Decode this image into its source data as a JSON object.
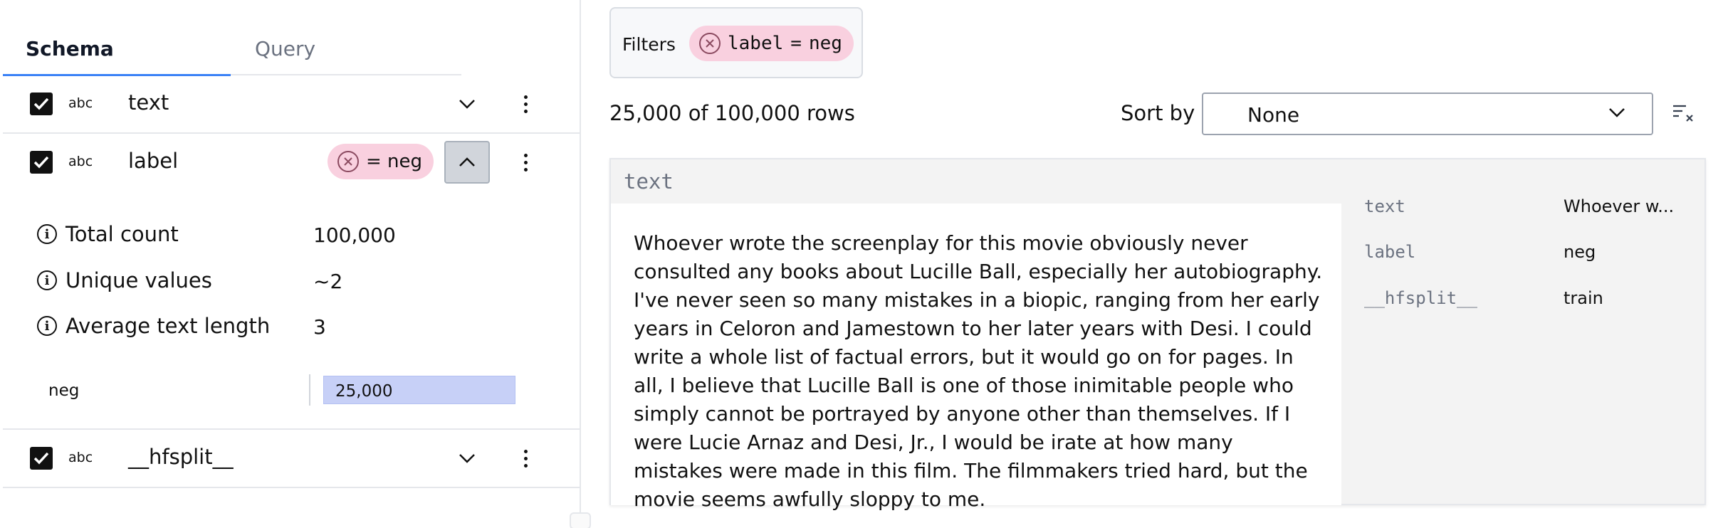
{
  "tabs": {
    "schema": "Schema",
    "query": "Query"
  },
  "schema_fields": [
    {
      "type_badge": "abc",
      "name": "text"
    },
    {
      "type_badge": "abc",
      "name": "label",
      "filter_text": "= neg"
    },
    {
      "type_badge": "abc",
      "name": "__hfsplit__"
    }
  ],
  "label_stats": {
    "total_count": {
      "label": "Total count",
      "value": "100,000"
    },
    "unique_values": {
      "label": "Unique values",
      "value": "~2"
    },
    "avg_text_length": {
      "label": "Average text length",
      "value": "3"
    },
    "histogram": [
      {
        "label": "neg",
        "value": "25,000",
        "fraction": 1.0
      }
    ]
  },
  "filters": {
    "label": "Filters",
    "pills": [
      {
        "field": "label",
        "op": "=",
        "value": "neg"
      }
    ]
  },
  "row_count": "25,000 of 100,000 rows",
  "sort": {
    "label": "Sort by",
    "value": "None"
  },
  "row_card": {
    "header": "text",
    "text": "Whoever wrote the screenplay for this movie obviously never consulted any books about Lucille Ball, especially her autobiography. I've never seen so many mistakes in a biopic, ranging from her early years in Celoron and Jamestown to her later years with Desi. I could write a whole list of factual errors, but it would go on for pages. In all, I believe that Lucille Ball is one of those inimitable people who simply cannot be portrayed by anyone other than themselves. If I were Lucie Arnaz and Desi, Jr., I would be irate at how many mistakes were made in this film. The filmmakers tried hard, but the movie seems awfully sloppy to me.",
    "meta": [
      {
        "key": "text",
        "value": "Whoever w..."
      },
      {
        "key": "label",
        "value": "neg"
      },
      {
        "key": "__hfsplit__",
        "value": "train"
      }
    ]
  },
  "colors": {
    "accent": "#3b82f6",
    "filter_pill": "#f9d0df",
    "hist_bar": "#c7d0f7"
  },
  "icons": [
    "checkbox-checked-icon",
    "chevron-down-icon",
    "chevron-up-icon",
    "kebab-menu-icon",
    "close-circle-icon",
    "info-icon",
    "clear-sort-icon"
  ]
}
